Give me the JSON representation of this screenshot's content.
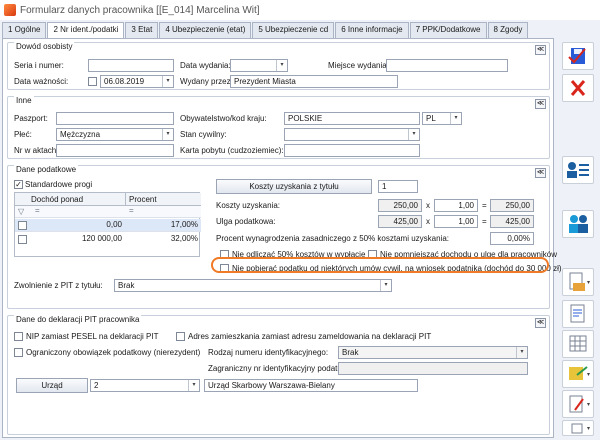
{
  "window": {
    "title": "Formularz danych pracownika [[E_014] Marcelina Wit]"
  },
  "tabs": [
    {
      "label": "1 Ogólne"
    },
    {
      "label": "2 Nr ident./podatki"
    },
    {
      "label": "3 Etat"
    },
    {
      "label": "4 Ubezpieczenie (etat)"
    },
    {
      "label": "5 Ubezpieczenie cd"
    },
    {
      "label": "6 Inne informacje"
    },
    {
      "label": "7 PPK/Dodatkowe"
    },
    {
      "label": "8 Zgody"
    }
  ],
  "dowod": {
    "header": "Dowód osobisty",
    "seria_label": "Seria i numer:",
    "seria_value": "",
    "data_wydania_label": "Data wydania:",
    "data_wydania_value": "",
    "miejsce_label": "Miejsce wydania:",
    "miejsce_value": "",
    "data_waznosci_label": "Data ważności:",
    "data_waznosci_value": "06.08.2019",
    "wydany_label": "Wydany przez:",
    "wydany_value": "Prezydent Miasta"
  },
  "inne": {
    "header": "Inne",
    "paszport_label": "Paszport:",
    "paszport_value": "",
    "plec_label": "Płeć:",
    "plec_value": "Mężczyzna",
    "nr_akt_label": "Nr w aktach:",
    "nr_akt_value": "",
    "obyw_label": "Obywatelstwo/kod kraju:",
    "obyw_value": "POLSKIE",
    "kod_kraju": "PL",
    "stan_label": "Stan cywilny:",
    "stan_value": "",
    "karta_label": "Karta pobytu (cudzoziemiec):",
    "karta_value": ""
  },
  "podatki": {
    "header": "Dane podatkowe",
    "standardowe_progi": "Standardowe progi",
    "col_dochod": "Dochód ponad",
    "col_procent": "Procent",
    "filter_eq": "=",
    "rows": [
      {
        "dochod": "0,00",
        "procent": "17,00%"
      },
      {
        "dochod": "120 000,00",
        "procent": "32,00%"
      }
    ],
    "koszty_btn": "Koszty uzyskania z tytułu",
    "koszty_count": "1",
    "koszty_label": "Koszty uzyskania:",
    "koszty_a": "250,00",
    "koszty_b": "1,00",
    "koszty_c": "250,00",
    "ulga_label": "Ulga podatkowa:",
    "ulga_a": "425,00",
    "ulga_b": "1,00",
    "ulga_c": "425,00",
    "x_sign": "x",
    "eq_sign": "=",
    "procent_label": "Procent wynagrodzenia zasadniczego z 50% kosztami uzyskania:",
    "procent_value": "0,00%",
    "nie_odliczac": "Nie odliczać 50% kosztów w wypłacie",
    "nie_pomniejszac": "Nie pomniejszać dochodu o ulgę dla pracowników",
    "nie_pobierac": "Nie pobierać podatku od niektórych umów cywil. na wniosek podatnika (dochód do 30 000 zł)",
    "zwolnienie_label": "Zwolnienie z PIT z tytułu:",
    "zwolnienie_value": "Brak"
  },
  "deklaracja": {
    "header": "Dane do deklaracji PIT pracownika",
    "nip_zamiast": "NIP zamiast PESEL na deklaracji PIT",
    "adres_zamiast": "Adres zamieszkania zamiast adresu zameldowania na deklaracji PIT",
    "ograniczony": "Ograniczony obowiązek podatkowy (nierezydent)",
    "rodzaj_label": "Rodzaj numeru identyfikacyjnego:",
    "rodzaj_value": "Brak",
    "zagraniczny_label": "Zagraniczny nr identyfikacyjny podatnika:",
    "zagraniczny_value": "",
    "urzad_btn": "Urząd",
    "urzad_code": "2",
    "urzad_name": "Urząd Skarbowy Warszawa-Bielany"
  },
  "symbols": {
    "collapse": "≪",
    "check": "✓",
    "arrow": "▾",
    "filter": "▽"
  },
  "colors": {
    "highlight": "#f07a25",
    "save": "#2a5bd7",
    "cancel": "#d9261c"
  }
}
